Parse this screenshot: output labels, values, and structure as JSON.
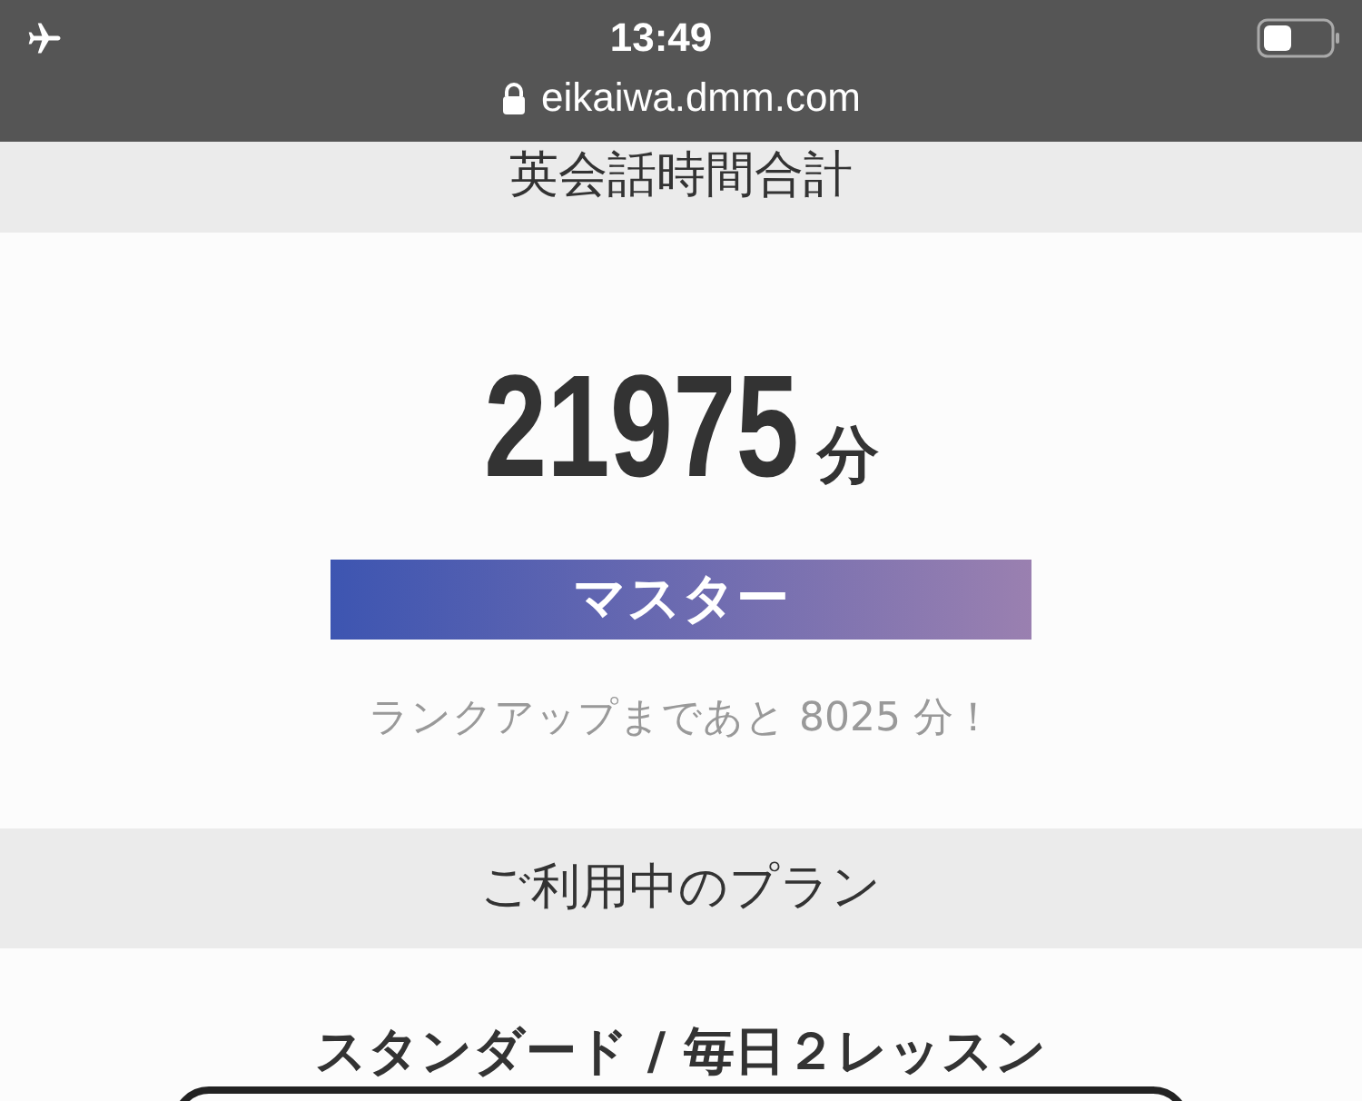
{
  "status_bar": {
    "time": "13:49",
    "url": "eikaiwa.dmm.com"
  },
  "total_section": {
    "heading": "英会話時間合計",
    "minutes": "21975",
    "unit": "分",
    "rank": "マスター",
    "rank_up_note": "ランクアップまであと 8025 分！"
  },
  "plan_section": {
    "heading": "ご利用中のプラン",
    "plan_name": "スタンダード / 毎日２レッスン"
  }
}
